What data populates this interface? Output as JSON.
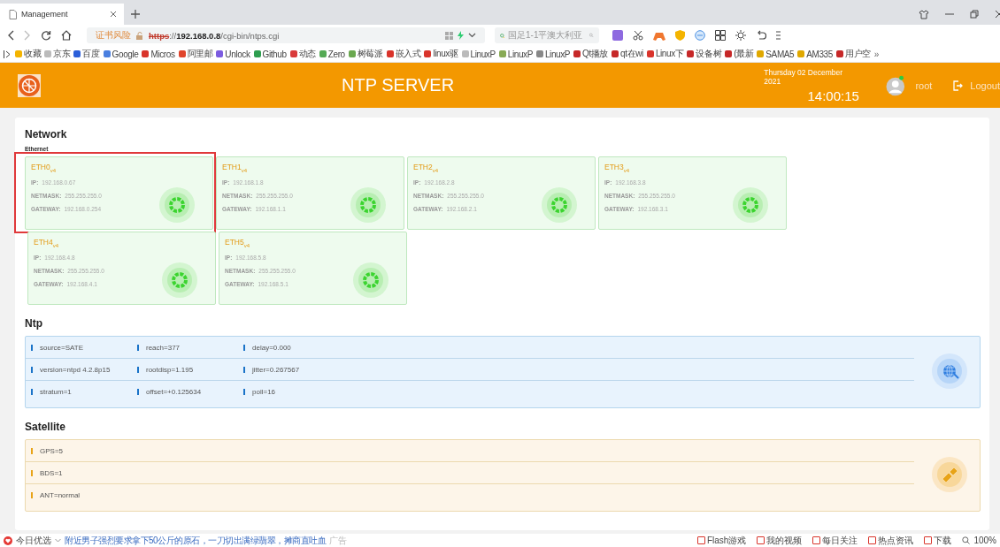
{
  "browser": {
    "tab": {
      "title": "Management"
    },
    "address": {
      "warning": "证书风险",
      "scheme": "https",
      "rest": "://**192.168.0.8**/cgi-bin/ntps.cgi"
    },
    "search": {
      "placeholder": "国足1-1平澳大利亚"
    },
    "bookmarks": [
      {
        "label": "收藏",
        "color": "#f4b400"
      },
      {
        "label": "京东",
        "color": "#bbbbbb"
      },
      {
        "label": "百度",
        "color": "#2b5fd9"
      },
      {
        "label": "Google",
        "color": "#4a7fe0"
      },
      {
        "label": "Micros",
        "color": "#d9342b"
      },
      {
        "label": "阿里邮",
        "color": "#e0442b"
      },
      {
        "label": "Unlock",
        "color": "#7c5ce0"
      },
      {
        "label": "Github",
        "color": "#2e9e4f"
      },
      {
        "label": "动态",
        "color": "#d93a3a"
      },
      {
        "label": "Zero",
        "color": "#55aa55"
      },
      {
        "label": "树莓派",
        "color": "#6aa84f"
      },
      {
        "label": "嵌入式",
        "color": "#d9342b"
      },
      {
        "label": "linux驱",
        "color": "#d9342b"
      },
      {
        "label": "LinuxP",
        "color": "#bbbbbb"
      },
      {
        "label": "LinuxP",
        "color": "#88aa55"
      },
      {
        "label": "LinuxP",
        "color": "#888888"
      },
      {
        "label": "Qt播放",
        "color": "#c62828"
      },
      {
        "label": "qt在wi",
        "color": "#c62828"
      },
      {
        "label": "Linux下",
        "color": "#d9342b"
      },
      {
        "label": "设备树",
        "color": "#c62828"
      },
      {
        "label": "(最新",
        "color": "#c62828"
      },
      {
        "label": "SAMA5",
        "color": "#e0a800"
      },
      {
        "label": "AM335",
        "color": "#e0a800"
      },
      {
        "label": "用户空",
        "color": "#c62828"
      }
    ],
    "more": "»"
  },
  "header": {
    "title": "NTP SERVER",
    "date": "Thursday 02 December 2021",
    "time": "14:00:15",
    "user": "root",
    "logout": "Logout"
  },
  "network": {
    "title": "Network",
    "subtitle": "Ethernet",
    "interfaces": [
      {
        "name": "ETH0$_{v4}$",
        "highlighted": true,
        "fields": [
          {
            "label": "IP:",
            "value": "192.168.0.67"
          },
          {
            "label": "NETMASK:",
            "value": "255.255.255.0"
          },
          {
            "label": "GATEWAY:",
            "value": "192.168.0.254"
          }
        ]
      },
      {
        "name": "ETH1$_{v4}$",
        "highlighted": false,
        "fields": [
          {
            "label": "IP:",
            "value": "192.168.1.8"
          },
          {
            "label": "NETMASK:",
            "value": "255.255.255.0"
          },
          {
            "label": "GATEWAY:",
            "value": "192.168.1.1"
          }
        ]
      },
      {
        "name": "ETH2$_{v4}$",
        "highlighted": false,
        "fields": [
          {
            "label": "IP:",
            "value": "192.168.2.8"
          },
          {
            "label": "NETMASK:",
            "value": "255.255.255.0"
          },
          {
            "label": "GATEWAY:",
            "value": "192.168.2.1"
          }
        ]
      },
      {
        "name": "ETH3$_{v4}$",
        "highlighted": false,
        "fields": [
          {
            "label": "IP:",
            "value": "192.168.3.8"
          },
          {
            "label": "NETMASK:",
            "value": "255.255.255.0"
          },
          {
            "label": "GATEWAY:",
            "value": "192.168.3.1"
          }
        ]
      },
      {
        "name": "ETH4$_{v4}$",
        "highlighted": false,
        "fields": [
          {
            "label": "IP:",
            "value": "192.168.4.8"
          },
          {
            "label": "NETMASK:",
            "value": "255.255.255.0"
          },
          {
            "label": "GATEWAY:",
            "value": "192.168.4.1"
          }
        ]
      },
      {
        "name": "ETH5$_{v4}$",
        "highlighted": false,
        "fields": [
          {
            "label": "IP:",
            "value": "192.168.5.8"
          },
          {
            "label": "NETMASK:",
            "value": "255.255.255.0"
          },
          {
            "label": "GATEWAY:",
            "value": "192.168.5.1"
          }
        ]
      }
    ]
  },
  "ntp": {
    "title": "Ntp",
    "rows": [
      [
        "source=SATE",
        "reach=377",
        "delay=0.000"
      ],
      [
        "version=ntpd 4.2.8p15",
        "rootdisp=1.195",
        "jitter=0.267567"
      ],
      [
        "stratum=1",
        "offset=+0.125634",
        "poll=16"
      ]
    ]
  },
  "satellite": {
    "title": "Satellite",
    "rows": [
      "GPS=5",
      "BDS=1",
      "ANT=normal"
    ]
  },
  "status_bar": {
    "left": [
      {
        "label": "今日优选"
      }
    ],
    "news": "附近男子强烈要求拿下50公斤的原石，一刀切出满绿翡翠，摊商直吐血",
    "ad": "广告",
    "right": [
      "Flash游戏",
      "我的视频",
      "每日关注",
      "热点资讯",
      "下载"
    ],
    "zoom": "100%"
  }
}
